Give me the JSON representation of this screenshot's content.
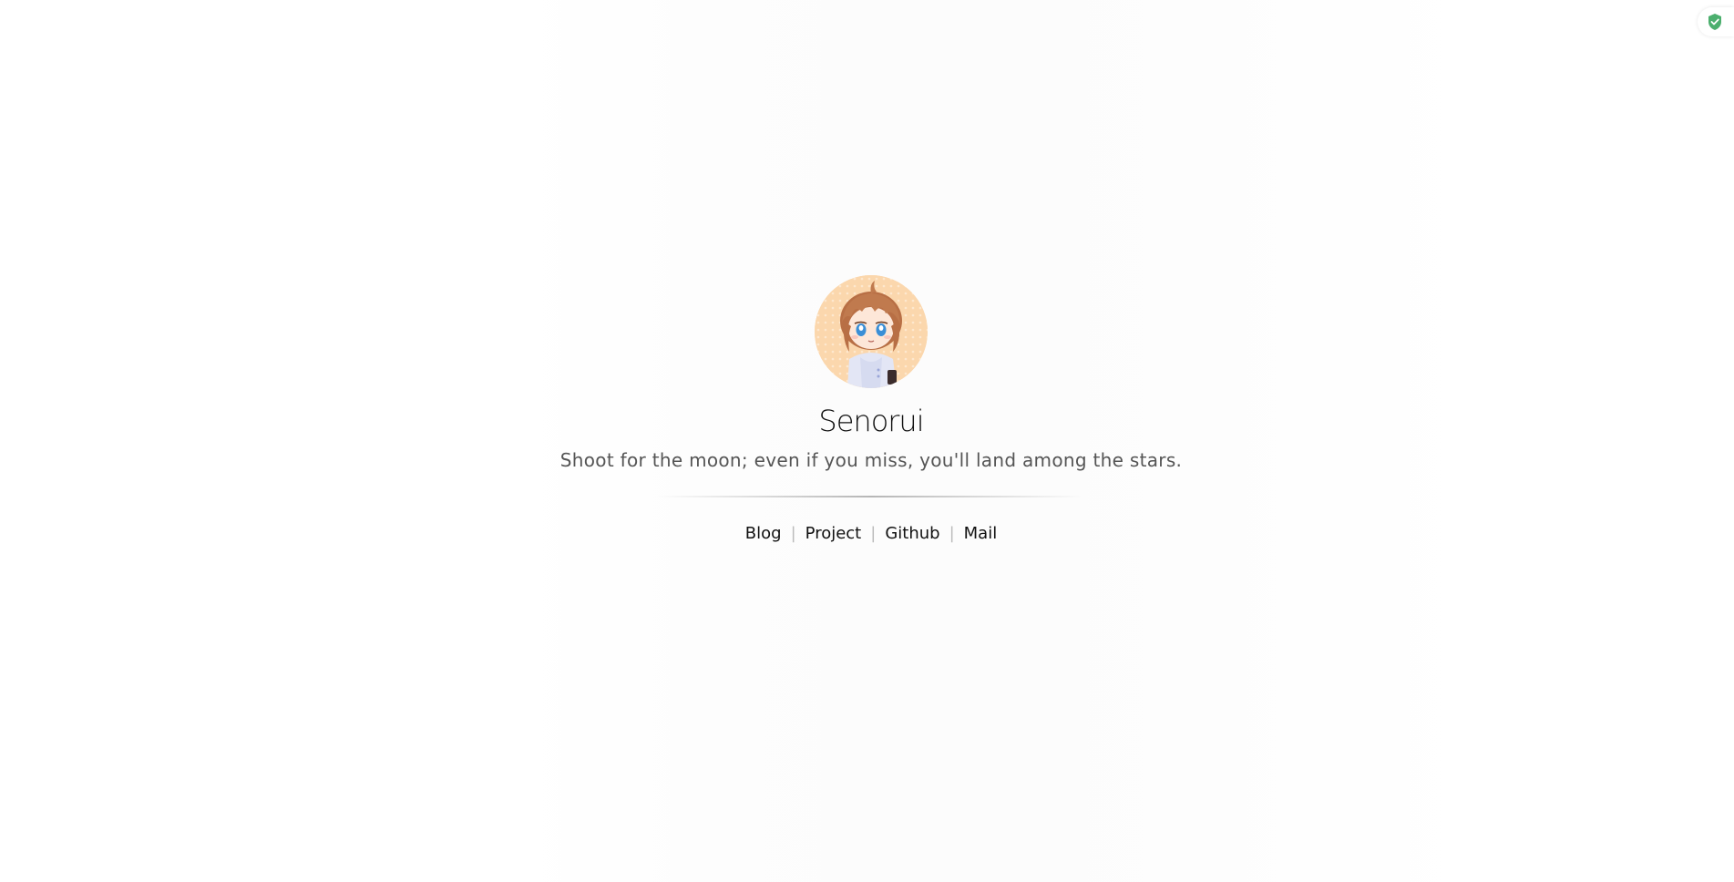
{
  "profile": {
    "name": "Senorui",
    "motto": "Shoot for the moon; even if you miss, you'll land among the stars."
  },
  "links": {
    "blog": "Blog",
    "project": "Project",
    "github": "Github",
    "mail": "Mail",
    "separator": "|"
  },
  "icons": {
    "corner_badge": "shield-check-icon",
    "avatar": "anime-avatar"
  },
  "colors": {
    "badge_green": "#4caf6e",
    "avatar_bg": "#fbd7ad",
    "hair": "#c07a4e",
    "eyes": "#3a8fd6"
  }
}
